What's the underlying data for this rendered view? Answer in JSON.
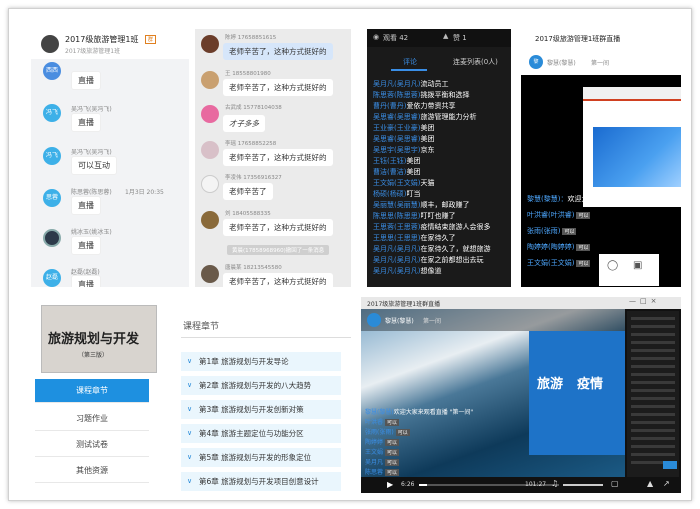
{
  "panel1": {
    "title": "2017级旅游管理1班",
    "subtitle": "2017级旅游管理1班",
    "badge": "群",
    "messages": [
      {
        "avatar": "西西",
        "avatar_color": "#4a8de0",
        "name": "",
        "text": "直播"
      },
      {
        "avatar": "冯飞",
        "avatar_color": "#3db0e8",
        "name": "吴冯飞(吴冯飞)",
        "text": "直播"
      },
      {
        "avatar": "冯飞",
        "avatar_color": "#3db0e8",
        "name": "吴冯飞(吴冯飞)",
        "text": "可以互动"
      },
      {
        "avatar": "思蓉",
        "avatar_color": "#3db0e8",
        "name": "陈思蓉(陈思蓉)",
        "text": "直播"
      },
      {
        "avatar": "",
        "avatar_color": "#2d3a4a",
        "name": "姚冰玉(姚冰玉)",
        "text": "直播"
      },
      {
        "avatar": "赵磊",
        "avatar_color": "#3db0e8",
        "name": "赵磊(赵磊)",
        "text": "直播"
      }
    ],
    "timestamp": "1月3日 20:35"
  },
  "panel2": {
    "messages": [
      {
        "name": "陈婷 17658851615",
        "text": "老师辛苦了，这种方式挺好的",
        "highlight": true,
        "avatar_color": "#6b3d2a"
      },
      {
        "name": "王 18558801980",
        "text": "老师辛苦了，这种方式挺好的",
        "highlight": false,
        "avatar_color": "#c9a070"
      },
      {
        "name": "古武成 15778104038",
        "text": "才子多多",
        "highlight": false,
        "avatar_color": "#e86aa0"
      },
      {
        "name": "李瑶 17658852258",
        "text": "老师辛苦了，这种方式挺好的",
        "highlight": false,
        "avatar_color": "#d8c0c8"
      },
      {
        "name": "李凌伟 17356916327",
        "text": "老师辛苦了",
        "highlight": false,
        "avatar_color": "#f0f0f0"
      },
      {
        "name": "刘 18405588335",
        "text": "老师辛苦了，这种方式挺好的",
        "highlight": false,
        "avatar_color": "#8a6a3a"
      },
      {
        "name": "",
        "text": "黄晨(17858968960)撤回了一条消息",
        "system": true
      },
      {
        "name": "唐晨某 18213545580",
        "text": "老师辛苦了，这种方式挺好的",
        "highlight": false,
        "avatar_color": "#6a5a4a"
      }
    ]
  },
  "panel3": {
    "views": "观看 42",
    "likes": "赞 1",
    "tab_comments": "评论",
    "tab_online": "连麦列表(0人)",
    "comments": [
      {
        "user": "吴月凡(吴月凡)",
        "msg": "流动员工"
      },
      {
        "user": "陈思蓉(陈思蓉)",
        "msg": "挑拨平衡和选择"
      },
      {
        "user": "曹丹(曹丹)",
        "msg": "爱依力带资共享"
      },
      {
        "user": "吴思睿(吴思睿)",
        "msg": "旅游管理能力分析"
      },
      {
        "user": "王业豪(王业豪)",
        "msg": "美团"
      },
      {
        "user": "吴思睿(吴思睿)",
        "msg": "美团"
      },
      {
        "user": "吴思宇(吴思宇)",
        "msg": "京东"
      },
      {
        "user": "王钰(王钰)",
        "msg": "美团"
      },
      {
        "user": "曹洁(曹洁)",
        "msg": "美团"
      },
      {
        "user": "王文娟(王文娟)",
        "msg": "天猫"
      },
      {
        "user": "杨硕(杨硕)",
        "msg": "叮当"
      },
      {
        "user": "吴丽慧(吴丽慧)",
        "msg": "顺丰，邮政赚了"
      },
      {
        "user": "陈思思(陈思思)",
        "msg": "叮叮也赚了"
      },
      {
        "user": "王思蓉(王思蓉)",
        "msg": "疫情结束旅游人会很多"
      },
      {
        "user": "王思思(王思思)",
        "msg": "在家待久了"
      },
      {
        "user": "吴月凡(吴月凡)",
        "msg": "在家待久了，就想旅游"
      },
      {
        "user": "吴月凡(吴月凡)",
        "msg": "在家之前都想出去玩"
      },
      {
        "user": "吴月凡(吴月凡)",
        "msg": "想像道"
      }
    ]
  },
  "panel4": {
    "title": "2017级旅游管理1班群直播",
    "host": "黎慧(黎慧)",
    "host_sub": "第一间",
    "comments": [
      {
        "user": "黎慧(黎慧)：",
        "msg": "欢迎大家来观看直播 \"第一间\""
      },
      {
        "user": "叶洪睿(叶洪睿)",
        "msg": "可以"
      },
      {
        "user": "张雨(张雨)",
        "msg": "可以"
      },
      {
        "user": "陶婷婷(陶婷婷)",
        "msg": "可以"
      },
      {
        "user": "王文娟(王文娟)",
        "msg": "可以"
      }
    ]
  },
  "panel5": {
    "book_title": "旅游规划与开发",
    "book_edition": "（第三版）",
    "menu": [
      "课程章节",
      "习题作业",
      "测试试卷",
      "其他资源"
    ],
    "section_title": "课程章节",
    "chapters": [
      "第1章 旅游规划与开发导论",
      "第2章 旅游规划与开发的八大趋势",
      "第3章 旅游规划与开发创新对策",
      "第4章 旅游主题定位与功能分区",
      "第5章 旅游规划与开发的形象定位",
      "第6章 旅游规划与开发项目创意设计"
    ]
  },
  "panel6": {
    "title": "2017级旅游管理1班群直播",
    "host": "黎慧(黎慧)",
    "host_sub": "第一间",
    "slide_title_a": "旅游",
    "slide_title_b": "疫情",
    "time_current": "6:26",
    "time_total": "101:27",
    "comments": [
      {
        "user": "黎慧(黎慧)",
        "msg": "欢迎大家来观看直播 \"第一间\""
      },
      {
        "user": "叶洪睿",
        "msg": "可以"
      },
      {
        "user": "张雨(张雨)",
        "msg": "可以"
      },
      {
        "user": "陶婷婷",
        "msg": "可以"
      },
      {
        "user": "王文娟",
        "msg": "可以"
      },
      {
        "user": "吴月凡",
        "msg": "可以"
      },
      {
        "user": "陈思蓉",
        "msg": "可以"
      }
    ]
  }
}
